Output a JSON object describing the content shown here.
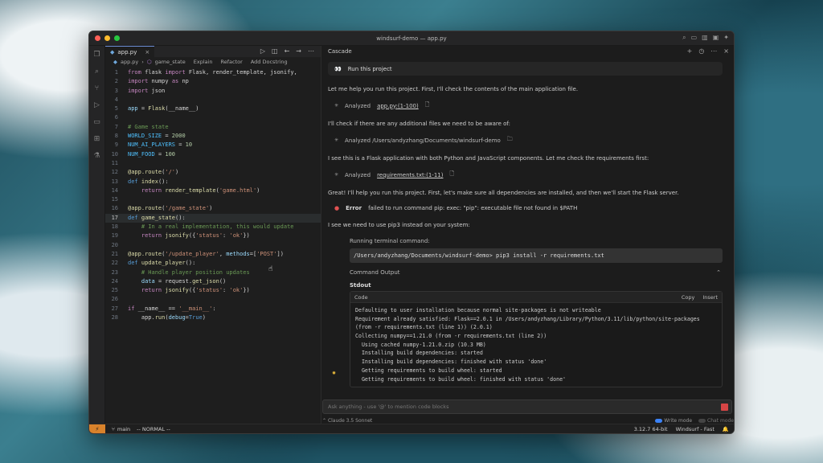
{
  "window": {
    "title": "windsurf-demo — app.py",
    "traffic_colors": [
      "#ff5f57",
      "#febc2e",
      "#28c840"
    ]
  },
  "editor": {
    "tab_label": "app.py",
    "breadcrumb": {
      "file": "app.py",
      "symbol": "game_state",
      "lenses": [
        "Explain",
        "Refactor",
        "Add Docstring"
      ]
    },
    "lines": [
      {
        "n": "1",
        "segs": [
          [
            "kw",
            "from "
          ],
          [
            "plain",
            "flask "
          ],
          [
            "kw",
            "import "
          ],
          [
            "plain",
            "Flask, render_template, jsonify,"
          ]
        ]
      },
      {
        "n": "2",
        "segs": [
          [
            "kw",
            "import "
          ],
          [
            "plain",
            "numpy "
          ],
          [
            "kw",
            "as "
          ],
          [
            "plain",
            "np"
          ]
        ]
      },
      {
        "n": "3",
        "segs": [
          [
            "kw",
            "import "
          ],
          [
            "plain",
            "json"
          ]
        ]
      },
      {
        "n": "4",
        "segs": []
      },
      {
        "n": "5",
        "segs": [
          [
            "prm",
            "app "
          ],
          [
            "plain",
            "= "
          ],
          [
            "fn",
            "Flask"
          ],
          [
            "plain",
            "(__name__)"
          ]
        ]
      },
      {
        "n": "6",
        "segs": []
      },
      {
        "n": "7",
        "segs": [
          [
            "cm",
            "# Game state"
          ]
        ]
      },
      {
        "n": "8",
        "segs": [
          [
            "const",
            "WORLD_SIZE "
          ],
          [
            "plain",
            "= "
          ],
          [
            "num",
            "2000"
          ]
        ]
      },
      {
        "n": "9",
        "segs": [
          [
            "const",
            "NUM_AI_PLAYERS "
          ],
          [
            "plain",
            "= "
          ],
          [
            "num",
            "10"
          ]
        ]
      },
      {
        "n": "10",
        "segs": [
          [
            "const",
            "NUM_FOOD "
          ],
          [
            "plain",
            "= "
          ],
          [
            "num",
            "100"
          ]
        ]
      },
      {
        "n": "11",
        "segs": []
      },
      {
        "n": "12",
        "segs": [
          [
            "dec",
            "@app.route"
          ],
          [
            "plain",
            "("
          ],
          [
            "str",
            "'/'"
          ],
          [
            "plain",
            ")"
          ]
        ]
      },
      {
        "n": "13",
        "segs": [
          [
            "kw2",
            "def "
          ],
          [
            "fn",
            "index"
          ],
          [
            "plain",
            "():"
          ]
        ]
      },
      {
        "n": "14",
        "segs": [
          [
            "plain",
            "    "
          ],
          [
            "kw",
            "return "
          ],
          [
            "fn",
            "render_template"
          ],
          [
            "plain",
            "("
          ],
          [
            "str",
            "'game.html'"
          ],
          [
            "plain",
            ")"
          ]
        ]
      },
      {
        "n": "15",
        "segs": []
      },
      {
        "n": "16",
        "segs": [
          [
            "dec",
            "@app.route"
          ],
          [
            "plain",
            "("
          ],
          [
            "str",
            "'/game_state'"
          ],
          [
            "plain",
            ")"
          ]
        ]
      },
      {
        "n": "17",
        "segs": [
          [
            "kw2",
            "def "
          ],
          [
            "fn",
            "game_state"
          ],
          [
            "plain",
            "():"
          ]
        ],
        "active": true
      },
      {
        "n": "18",
        "segs": [
          [
            "plain",
            "    "
          ],
          [
            "cm",
            "# In a real implementation, this would update"
          ]
        ]
      },
      {
        "n": "19",
        "segs": [
          [
            "plain",
            "    "
          ],
          [
            "kw",
            "return "
          ],
          [
            "fn",
            "jsonify"
          ],
          [
            "plain",
            "({"
          ],
          [
            "str",
            "'status'"
          ],
          [
            "plain",
            ": "
          ],
          [
            "str",
            "'ok'"
          ],
          [
            "plain",
            "})"
          ]
        ]
      },
      {
        "n": "20",
        "segs": []
      },
      {
        "n": "21",
        "segs": [
          [
            "dec",
            "@app.route"
          ],
          [
            "plain",
            "("
          ],
          [
            "str",
            "'/update_player'"
          ],
          [
            "plain",
            ", "
          ],
          [
            "prm",
            "methods"
          ],
          [
            "plain",
            "=["
          ],
          [
            "str",
            "'POST'"
          ],
          [
            "plain",
            "])"
          ]
        ]
      },
      {
        "n": "22",
        "segs": [
          [
            "kw2",
            "def "
          ],
          [
            "fn",
            "update_player"
          ],
          [
            "plain",
            "():"
          ]
        ]
      },
      {
        "n": "23",
        "segs": [
          [
            "plain",
            "    "
          ],
          [
            "cm",
            "# Handle player position updates"
          ]
        ]
      },
      {
        "n": "24",
        "segs": [
          [
            "plain",
            "    "
          ],
          [
            "prm",
            "data "
          ],
          [
            "plain",
            "= request."
          ],
          [
            "fn",
            "get_json"
          ],
          [
            "plain",
            "()"
          ]
        ]
      },
      {
        "n": "25",
        "segs": [
          [
            "plain",
            "    "
          ],
          [
            "kw",
            "return "
          ],
          [
            "fn",
            "jsonify"
          ],
          [
            "plain",
            "({"
          ],
          [
            "str",
            "'status'"
          ],
          [
            "plain",
            ": "
          ],
          [
            "str",
            "'ok'"
          ],
          [
            "plain",
            "})"
          ]
        ]
      },
      {
        "n": "26",
        "segs": []
      },
      {
        "n": "27",
        "segs": [
          [
            "kw",
            "if "
          ],
          [
            "plain",
            "__name__ == "
          ],
          [
            "str",
            "'__main__'"
          ],
          [
            "plain",
            ":"
          ]
        ]
      },
      {
        "n": "28",
        "segs": [
          [
            "plain",
            "    app."
          ],
          [
            "fn",
            "run"
          ],
          [
            "plain",
            "("
          ],
          [
            "prm",
            "debug"
          ],
          [
            "plain",
            "="
          ],
          [
            "kw2",
            "True"
          ],
          [
            "plain",
            ")"
          ]
        ]
      }
    ]
  },
  "chat": {
    "header_title": "Cascade",
    "user_message": "Run this project",
    "msg1": "Let me help you run this project. First, I'll check the contents of the main application file.",
    "analyzed1_prefix": "Analyzed",
    "analyzed1_link": "app.py:(1-100)",
    "msg2": "I'll check if there are any additional files we need to be aware of:",
    "analyzed2": "Analyzed /Users/andyzhang/Documents/windsurf-demo",
    "msg3": "I see this is a Flask application with both Python and JavaScript components. Let me check the requirements first:",
    "analyzed3_prefix": "Analyzed",
    "analyzed3_link": "requirements.txt:(1-11)",
    "msg4": "Great! I'll help you run this project. First, let's make sure all dependencies are installed, and then we'll start the Flask server.",
    "error_label": "Error",
    "error_text": "failed to run command pip: exec: \"pip\": executable file not found in $PATH",
    "msg5": "I see we need to use pip3 instead on your system:",
    "terminal_label": "Running terminal command:",
    "terminal_cmd": "/Users/andyzhang/Documents/windsurf-demo> pip3 install -r requirements.txt",
    "command_output_label": "Command Output",
    "stdout_label": "Stdout",
    "code_label": "Code",
    "copy_label": "Copy",
    "insert_label": "Insert",
    "output_lines": [
      "Defaulting to user installation because normal site-packages is not writeable",
      "Requirement already satisfied: Flask==2.0.1 in /Users/andyzhang/Library/Python/3.11/lib/python/site-packages",
      "(from -r requirements.txt (line 1)) (2.0.1)",
      "Collecting numpy==1.21.0 (from -r requirements.txt (line 2))",
      "  Using cached numpy-1.21.0.zip (10.3 MB)",
      "  Installing build dependencies: started",
      "  Installing build dependencies: finished with status 'done'",
      "  Getting requirements to build wheel: started",
      "  Getting requirements to build wheel: finished with status 'done'"
    ],
    "input_placeholder": "Ask anything - use '@' to mention code blocks",
    "model": "Claude 3.5 Sonnet",
    "write_mode": "Write mode",
    "chat_mode": "Chat mode"
  },
  "statusbar": {
    "branch": "main",
    "mode": "-- NORMAL --",
    "python": "3.12.7 64-bit",
    "app": "Windsurf - Fast"
  },
  "colors": {
    "accent": "#d9822b",
    "error": "#e05252",
    "stop": "#d64545"
  }
}
